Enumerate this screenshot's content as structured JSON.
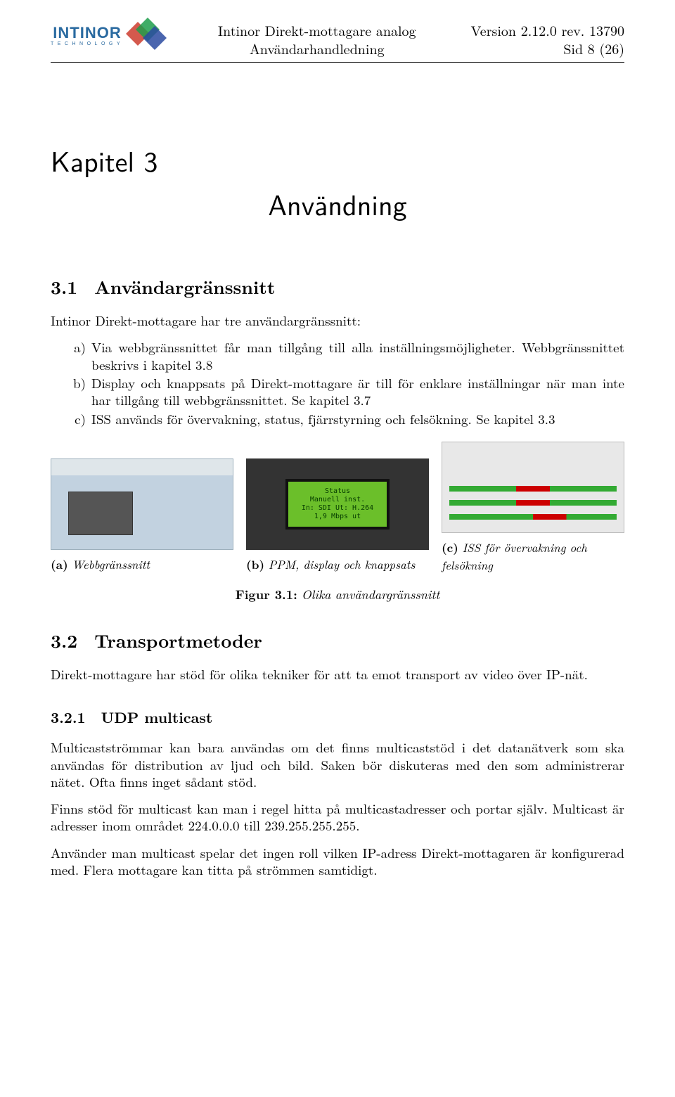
{
  "header": {
    "logo_text": "INTINOR",
    "logo_sub": "TECHNOLOGY",
    "center_line1": "Intinor Direkt-mottagare analog",
    "center_line2": "Användarhandledning",
    "right_line1": "Version 2.12.0 rev. 13790",
    "right_line2": "Sid 8 (26)"
  },
  "chapter": {
    "num_label": "Kapitel  3",
    "title": "Användning"
  },
  "sec31": {
    "num": "3.1",
    "title": "Användargränssnitt",
    "intro": "Intinor Direkt-mottagare har tre användargränssnitt:",
    "items": [
      {
        "marker": "a)",
        "text": "Via webbgränssnittet får man tillgång till alla inställningsmöjligheter. Webbgränssnittet beskrivs i kapitel 3.8"
      },
      {
        "marker": "b)",
        "text": "Display och knappsats på Direkt-mottagare är till för enklare inställningar när man inte har tillgång till webbgränssnittet. Se kapitel 3.7"
      },
      {
        "marker": "c)",
        "text": "ISS används för övervakning, status, fjärrstyrning och felsökning. Se kapitel 3.3"
      }
    ]
  },
  "figure": {
    "lcd_lines": [
      "Status",
      "Manuell inst.",
      "In: SDI Ut: H.264",
      "1,9 Mbps ut"
    ],
    "subcaptions": [
      {
        "label": "(a)",
        "text": "Webbgränssnitt"
      },
      {
        "label": "(b)",
        "text": "PPM, display och knappsats"
      },
      {
        "label": "(c)",
        "text": "ISS för övervakning och felsökning"
      }
    ],
    "caption_label": "Figur 3.1:",
    "caption_text": "Olika användargränssnitt"
  },
  "sec32": {
    "num": "3.2",
    "title": "Transportmetoder",
    "para": "Direkt-mottagare har stöd för olika tekniker för att ta emot transport av video över IP-nät."
  },
  "sec321": {
    "num": "3.2.1",
    "title": "UDP multicast",
    "p1": "Multicastströmmar kan bara användas om det finns multicaststöd i det datanätverk som ska användas för distribution av ljud och bild. Saken bör diskuteras med den som administrerar nätet. Ofta finns inget sådant stöd.",
    "p2": "Finns stöd för multicast kan man i regel hitta på multicastadresser och portar själv. Multicast är adresser inom området 224.0.0.0 till 239.255.255.255.",
    "p3": "Använder man multicast spelar det ingen roll vilken IP-adress Direkt-mottagaren är konfigurerad med. Flera mottagare kan titta på strömmen samtidigt."
  }
}
